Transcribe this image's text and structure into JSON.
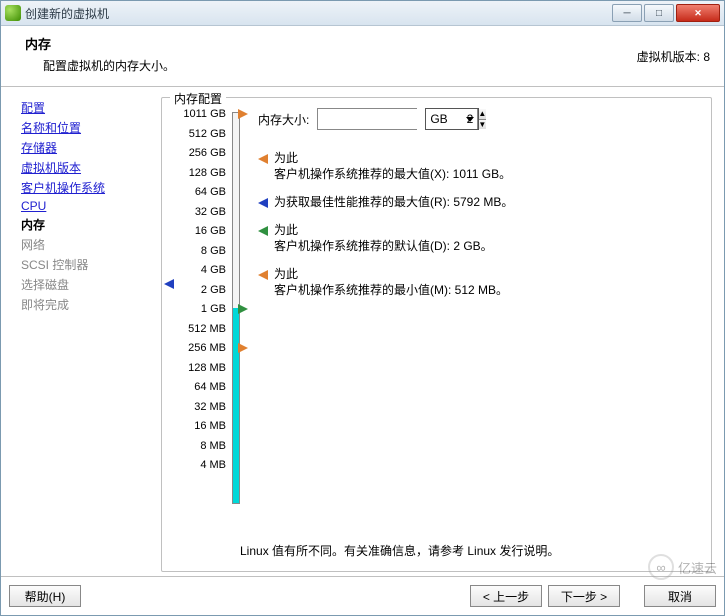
{
  "window": {
    "title": "创建新的虚拟机"
  },
  "header": {
    "title": "内存",
    "desc": "配置虚拟机的内存大小。",
    "version_label": "虚拟机版本: 8"
  },
  "sidebar": {
    "items": [
      {
        "label": "配置",
        "state": "done"
      },
      {
        "label": "名称和位置",
        "state": "done"
      },
      {
        "label": "存储器",
        "state": "done"
      },
      {
        "label": "虚拟机版本",
        "state": "done"
      },
      {
        "label": "客户机操作系统",
        "state": "done"
      },
      {
        "label": "CPU",
        "state": "done"
      },
      {
        "label": "内存",
        "state": "current"
      },
      {
        "label": "网络",
        "state": "future"
      },
      {
        "label": "SCSI 控制器",
        "state": "future"
      },
      {
        "label": "选择磁盘",
        "state": "future"
      },
      {
        "label": "即将完成",
        "state": "future"
      }
    ]
  },
  "memory": {
    "legend": "内存配置",
    "size_label": "内存大小:",
    "size_value": "2",
    "unit": "GB",
    "slider_ticks": [
      "1011 GB",
      "512 GB",
      "256 GB",
      "128 GB",
      "64 GB",
      "32 GB",
      "16 GB",
      "8 GB",
      "4 GB",
      "2 GB",
      "1 GB",
      "512 MB",
      "256 MB",
      "128 MB",
      "64 MB",
      "32 MB",
      "16 MB",
      "8 MB",
      "4 MB"
    ],
    "recs": [
      {
        "color": "orange",
        "line1": "为此",
        "line2": "客户机操作系统推荐的最大值(X): ",
        "val": "1011 GB。"
      },
      {
        "color": "blue",
        "line1": "",
        "line2": "为获取最佳性能推荐的最大值(R): ",
        "val": "5792 MB。"
      },
      {
        "color": "green",
        "line1": "为此",
        "line2": "客户机操作系统推荐的默认值(D): ",
        "val": "2 GB。"
      },
      {
        "color": "orange",
        "line1": "为此",
        "line2": "客户机操作系统推荐的最小值(M): ",
        "val": "512 MB。"
      }
    ],
    "footer": "Linux 值有所不同。有关准确信息，请参考 Linux 发行说明。"
  },
  "buttons": {
    "help": "帮助(H)",
    "back": "< 上一步",
    "next": "下一步 >",
    "cancel": "取消"
  },
  "watermark": {
    "text": "亿速云"
  }
}
